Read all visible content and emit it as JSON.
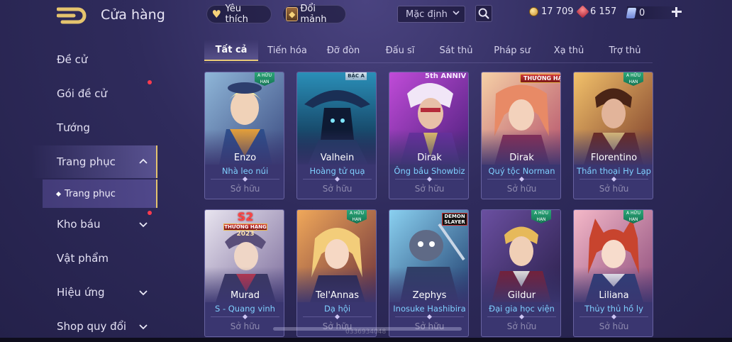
{
  "header": {
    "title": "Cửa hàng",
    "favorites_label": "Yêu thích",
    "shards_label": "Đổi mảnh",
    "sort_value": "Mặc định",
    "gold": "17 709",
    "ruby": "6 157",
    "vouchers": "0"
  },
  "sidebar": {
    "items": [
      {
        "label": "Đề cử"
      },
      {
        "label": "Gói đề cử"
      },
      {
        "label": "Tướng"
      },
      {
        "label": "Trang phục"
      },
      {
        "label": "Kho báu"
      },
      {
        "label": "Vật phẩm"
      },
      {
        "label": "Hiệu ứng"
      },
      {
        "label": "Shop quy đổi"
      }
    ],
    "subitem": "Trang phục"
  },
  "tabs": [
    "Tất cả",
    "Tiến hóa",
    "Đỡ đòn",
    "Đấu sĩ",
    "Sát thủ",
    "Pháp sư",
    "Xạ thủ",
    "Trợ thủ"
  ],
  "cards": [
    {
      "hero": "Enzo",
      "skin": "Nhà leo núi",
      "status": "Sở hữu",
      "tag": "A HỮU HẠN"
    },
    {
      "hero": "Valhein",
      "skin": "Hoàng tử quạ",
      "status": "Sở hữu",
      "tag": "BẬC A"
    },
    {
      "hero": "Dirak",
      "skin": "Ông bầu Showbiz",
      "status": "Sở hữu",
      "tag": "5th ANNIV"
    },
    {
      "hero": "Dirak",
      "skin": "Quý tộc Norman",
      "status": "Sở hữu",
      "tag": "THƯỜNG HẠNG"
    },
    {
      "hero": "Florentino",
      "skin": "Thần thoại Hy Lạp",
      "status": "Sở hữu",
      "tag": "A HỮU HẠN"
    },
    {
      "hero": "Murad",
      "skin": "S - Quang vinh",
      "status": "Sở hữu",
      "tag": "S2",
      "tag_band": "THƯỜNG HẠNG",
      "tag_year": "2023"
    },
    {
      "hero": "Tel'Annas",
      "skin": "Dạ hội",
      "status": "Sở hữu",
      "tag": "A HỮU HẠN"
    },
    {
      "hero": "Zephys",
      "skin": "Inosuke Hashibira",
      "status": "Sở hữu",
      "tag": "DEMON SLAYER"
    },
    {
      "hero": "Gildur",
      "skin": "Đại gia học viện",
      "status": "Sở hữu",
      "tag": "A HỮU HẠN"
    },
    {
      "hero": "Liliana",
      "skin": "Thủy thủ hồ ly",
      "status": "Sở hữu",
      "tag": "A HỮU HẠN"
    }
  ],
  "watermark": "0336934048",
  "colors": {
    "accent_gold": "#e8c978",
    "skin_name_blue": "#7fd0ff",
    "notification_red": "#ff3b4e",
    "tag_green": "#2ea97a"
  },
  "icons": {
    "back": "back-arrow-icon",
    "favorites": "heart-icon",
    "shards": "shard-chest-icon",
    "search": "search-icon",
    "gold": "gold-coin-icon",
    "ruby": "ruby-icon",
    "voucher": "voucher-icon",
    "add": "plus-icon"
  }
}
